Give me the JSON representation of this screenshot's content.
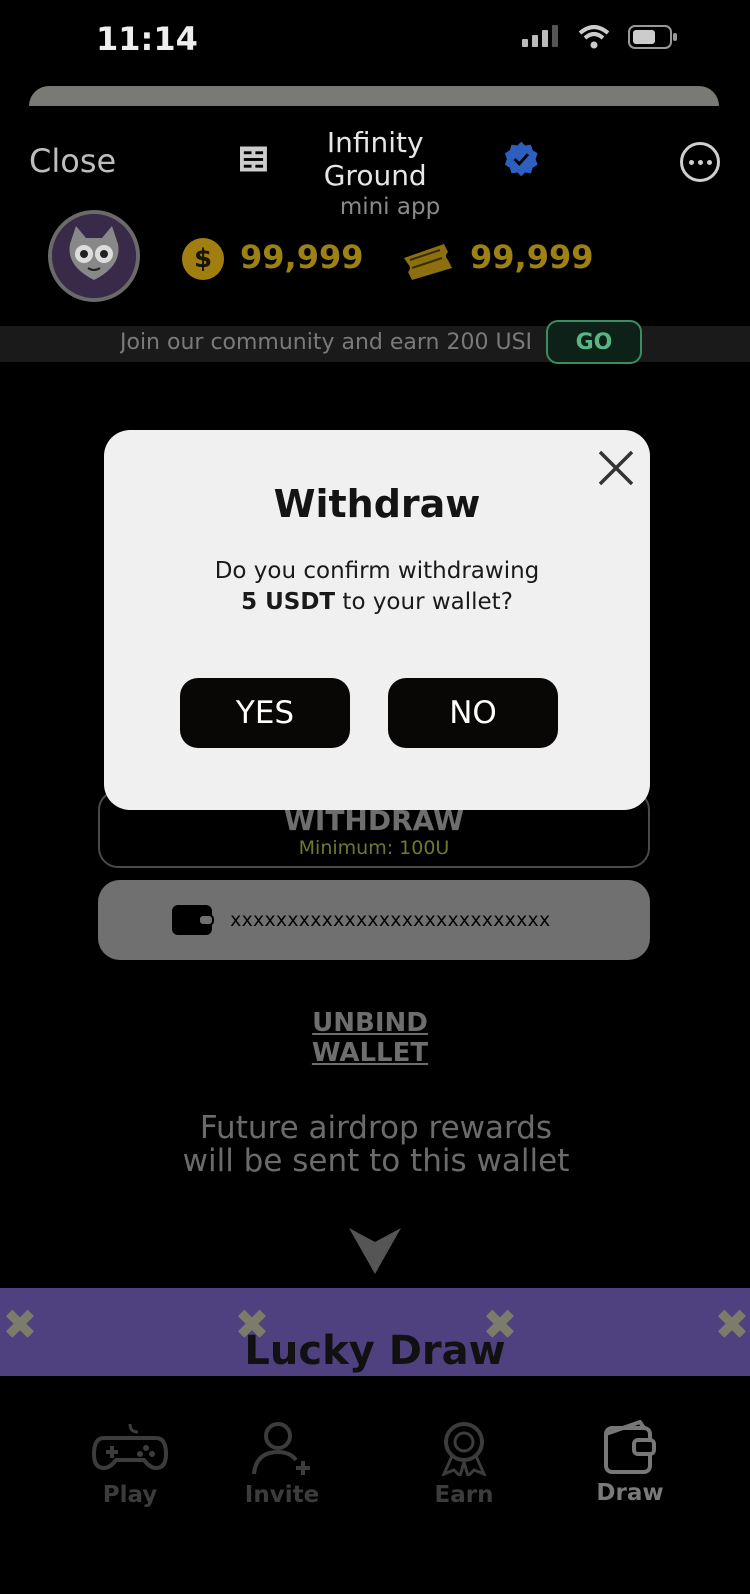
{
  "status_bar": {
    "time": "11:14"
  },
  "header": {
    "close_label": "Close",
    "app_title": "Infinity Ground",
    "app_subtitle": "mini app",
    "verified_icon": "verified-badge-icon",
    "more_icon": "more-options-icon"
  },
  "balances": {
    "coins": "99,999",
    "tickets": "99,999"
  },
  "marquee": {
    "text": "Join our community and earn 200 USDT",
    "go_label": "GO"
  },
  "main": {
    "withdraw_label": "WITHDRAW",
    "withdraw_minimum": "Minimum: 100U",
    "wallet_address": "xxxxxxxxxxxxxxxxxxxxxxxxxxxx",
    "unbind_label": "UNBIND WALLET",
    "future_line1": "Future airdrop rewards",
    "future_line2": "will be sent to this wallet",
    "lucky_draw": "Lucky Draw"
  },
  "nav": {
    "items": [
      {
        "label": "Play",
        "icon": "gamepad-icon"
      },
      {
        "label": "Invite",
        "icon": "add-user-icon"
      },
      {
        "label": "Earn",
        "icon": "medal-icon"
      },
      {
        "label": "Draw",
        "icon": "wallet-icon",
        "active": true
      }
    ]
  },
  "modal": {
    "title": "Withdraw",
    "line1": "Do you confirm withdrawing",
    "amount": "5 USDT",
    "line2_rest": " to your wallet?",
    "yes_label": "YES",
    "no_label": "NO"
  },
  "colors": {
    "gold": "#9d8112",
    "lucky_bar": "#4f4080",
    "go_green": "#5ab483",
    "modal_bg": "#f0f0f0",
    "verified_blue": "#2f6fe0"
  }
}
